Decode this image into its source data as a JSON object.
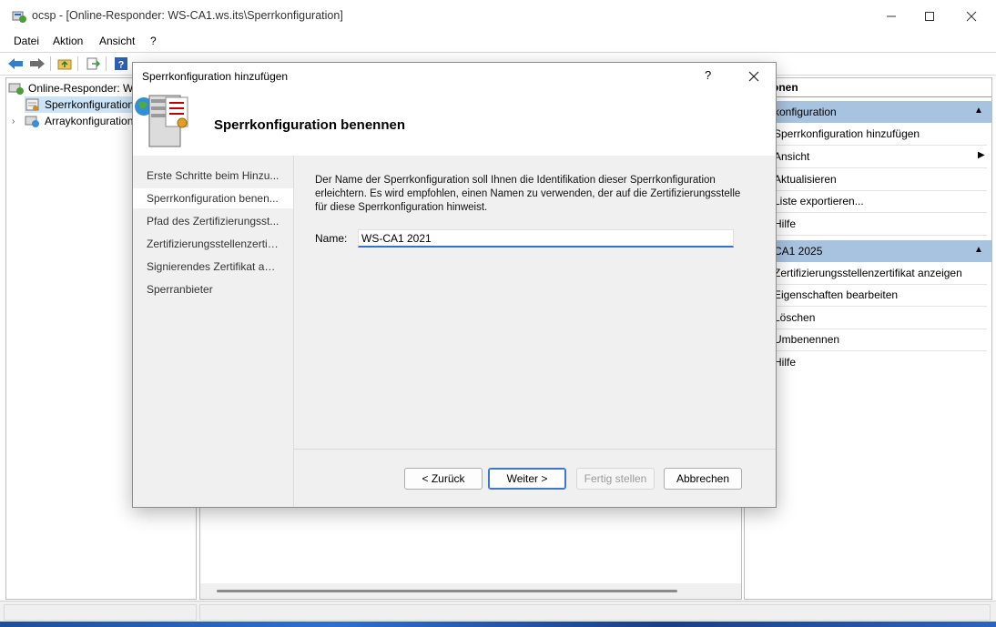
{
  "window": {
    "title": "ocsp - [Online-Responder: WS-CA1.ws.its\\Sperrkonfiguration]"
  },
  "menu": [
    "Datei",
    "Aktion",
    "Ansicht",
    "?"
  ],
  "tree": {
    "root": "Online-Responder: WS",
    "items": [
      "Sperrkonfiguration",
      "Arraykonfiguration"
    ]
  },
  "actions": {
    "title": "onen",
    "section1": {
      "header": "konfiguration",
      "items": [
        "Sperrkonfiguration hinzufügen",
        "Ansicht",
        "Aktualisieren",
        "Liste exportieren...",
        "Hilfe"
      ]
    },
    "section2": {
      "header": "CA1 2025",
      "items": [
        "Zertifizierungsstellenzertifikat anzeigen",
        "Eigenschaften bearbeiten",
        "Löschen",
        "Umbenennen",
        "Hilfe"
      ]
    }
  },
  "dialog": {
    "title": "Sperrkonfiguration hinzufügen",
    "help": "?",
    "heading": "Sperrkonfiguration benennen",
    "steps": [
      "Erste Schritte beim Hinzu...",
      "Sperrkonfiguration benen...",
      "Pfad des Zertifizierungsst...",
      "Zertifizierungsstellenzertif...",
      "Signierendes Zertifikat au...",
      "Sperranbieter"
    ],
    "active_step": 1,
    "description": "Der Name der Sperrkonfiguration soll Ihnen die Identifikation dieser Sperrkonfiguration erleichtern. Es wird empfohlen, einen Namen zu verwenden, der auf die Zertifizierungsstelle für diese Sperrkonfiguration hinweist.",
    "name_label": "Name:",
    "name_value": "WS-CA1 2021",
    "buttons": {
      "back": "< Zurück",
      "next": "Weiter >",
      "finish": "Fertig stellen",
      "cancel": "Abbrechen"
    }
  },
  "colors": {
    "accent": "#3470c4",
    "action_header": "#a8c3e0",
    "selection": "#cce4f7"
  }
}
